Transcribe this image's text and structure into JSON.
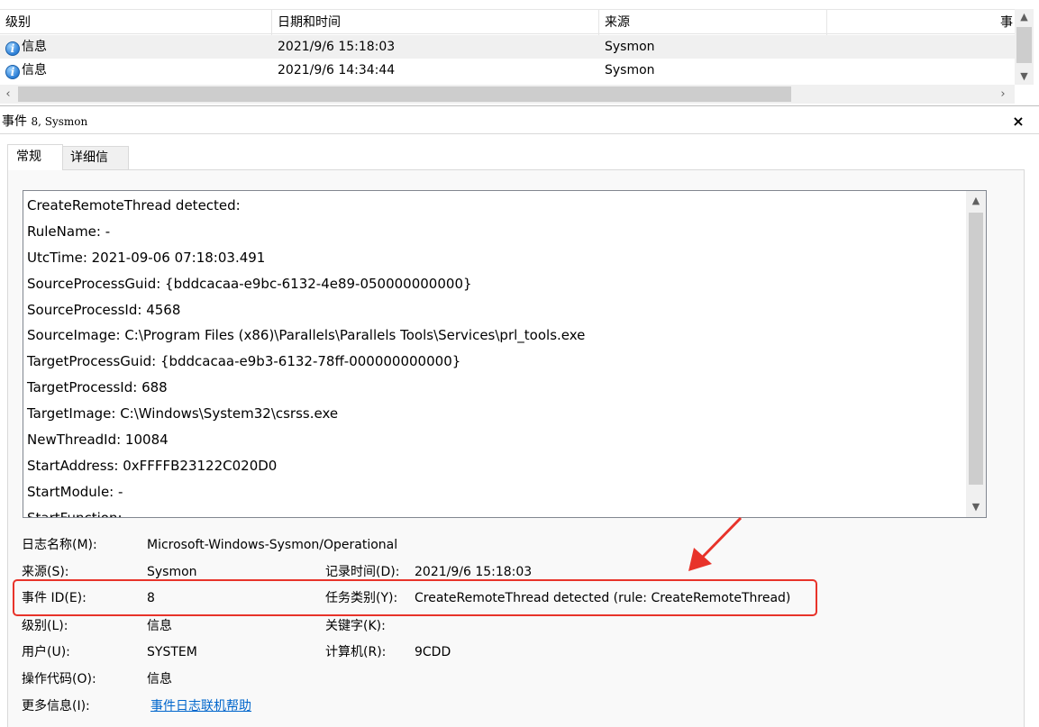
{
  "grid": {
    "headers": {
      "level": "级别",
      "datetime": "日期和时间",
      "source": "来源",
      "event_trunc": "事"
    },
    "rows": [
      {
        "level": "信息",
        "datetime": "2021/9/6 15:18:03",
        "source": "Sysmon"
      },
      {
        "level": "信息",
        "datetime": "2021/9/6 14:34:44",
        "source": "Sysmon"
      }
    ]
  },
  "detail": {
    "title_prefix": "事件",
    "title_suffix": "8, Sysmon",
    "close": "×",
    "tabs": {
      "general": "常规",
      "details": "详细信息"
    },
    "message_lines": [
      "CreateRemoteThread detected:",
      "RuleName: -",
      "UtcTime: 2021-09-06 07:18:03.491",
      "SourceProcessGuid: {bddcacaa-e9bc-6132-4e89-050000000000}",
      "SourceProcessId: 4568",
      "SourceImage: C:\\Program Files (x86)\\Parallels\\Parallels Tools\\Services\\prl_tools.exe",
      "TargetProcessGuid: {bddcacaa-e9b3-6132-78ff-000000000000}",
      "TargetProcessId: 688",
      "TargetImage: C:\\Windows\\System32\\csrss.exe",
      "NewThreadId: 10084",
      "StartAddress: 0xFFFFB23122C020D0",
      "StartModule: -",
      "StartFunction: -"
    ],
    "fields": {
      "log_name_label": "日志名称(M):",
      "log_name": "Microsoft-Windows-Sysmon/Operational",
      "source_label": "来源(S):",
      "source": "Sysmon",
      "logged_label": "记录时间(D):",
      "logged": "2021/9/6 15:18:03",
      "event_id_label": "事件 ID(E):",
      "event_id": "8",
      "task_label": "任务类别(Y):",
      "task": "CreateRemoteThread detected (rule: CreateRemoteThread)",
      "level_label": "级别(L):",
      "level": "信息",
      "keywords_label": "关键字(K):",
      "keywords": "",
      "user_label": "用户(U):",
      "user": "SYSTEM",
      "computer_label": "计算机(R):",
      "computer": "9CDD",
      "opcode_label": "操作代码(O):",
      "opcode": "信息",
      "more_info_label": "更多信息(I):",
      "more_info_link": "事件日志联机帮助"
    }
  },
  "colors": {
    "annotation": "#e8332a",
    "link": "#0066cc"
  }
}
